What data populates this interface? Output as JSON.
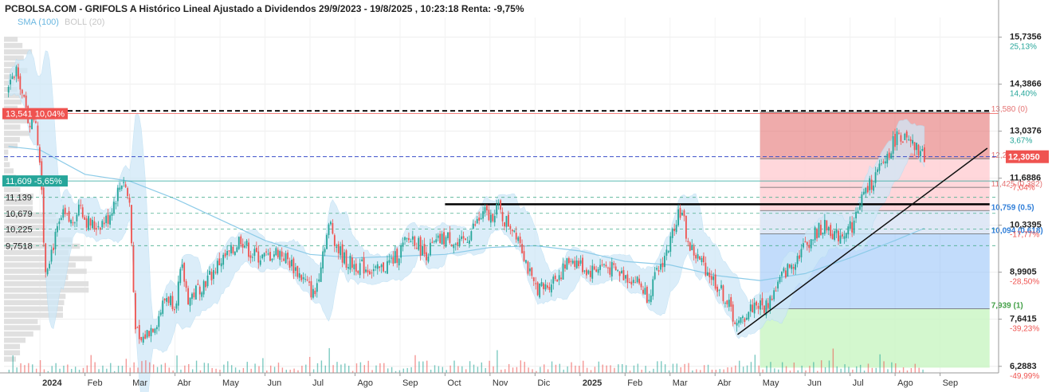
{
  "header": {
    "title": "PCBOLSA.COM - GRIFOLS A Histórico Lineal Ajustado a Dividendos 29/9/2023 - 19/8/2025 , 10:23:18 Renta: -9,75%"
  },
  "indicators": {
    "sma": "SMA (100)",
    "boll": "BOLL (20)"
  },
  "colors": {
    "up": "#26a69a",
    "down": "#ef5350",
    "sma": "#8ccbe8",
    "boll_fill": "#cfe8f7",
    "fib_red": "#e57373",
    "fib_pink": "#ffcdd2",
    "fib_blue": "#90c0f8",
    "fib_green": "#c8f5c2",
    "price_tag": "#ef5350",
    "green_tag": "#26a69a"
  },
  "chart_data": {
    "type": "candlestick",
    "ylim": [
      6.1,
      16.3
    ],
    "y_ticks": [
      {
        "value": 15.7356,
        "label": "15,7356",
        "pct": "25,13%",
        "pct_color": "#26a69a"
      },
      {
        "value": 14.3866,
        "label": "14,3866",
        "pct": "14,40%",
        "pct_color": "#26a69a"
      },
      {
        "value": 13.0376,
        "label": "13,0376",
        "pct": "3,67%",
        "pct_color": "#26a69a"
      },
      {
        "value": 11.6886,
        "label": "11,6886",
        "pct": "-7,04%",
        "pct_color": "#ef5350"
      },
      {
        "value": 10.3395,
        "label": "10,3395",
        "pct": "-17,77%",
        "pct_color": "#ef5350"
      },
      {
        "value": 8.9905,
        "label": "8,9905",
        "pct": "-28,50%",
        "pct_color": "#ef5350"
      },
      {
        "value": 7.6415,
        "label": "7,6415",
        "pct": "-39,23%",
        "pct_color": "#ef5350"
      },
      {
        "value": 6.2883,
        "label": "6,2883",
        "pct": "-49,99%",
        "pct_color": "#ef5350"
      }
    ],
    "x_ticks": [
      {
        "label": "2024",
        "t": 0.0,
        "bold": true
      },
      {
        "label": "Feb",
        "t": 1.0
      },
      {
        "label": "Mar",
        "t": 2.0
      },
      {
        "label": "Abr",
        "t": 3.0
      },
      {
        "label": "May",
        "t": 4.0
      },
      {
        "label": "Jun",
        "t": 5.0
      },
      {
        "label": "Jul",
        "t": 6.0
      },
      {
        "label": "Ago",
        "t": 7.0
      },
      {
        "label": "Sep",
        "t": 8.0
      },
      {
        "label": "Oct",
        "t": 9.0
      },
      {
        "label": "Nov",
        "t": 10.0
      },
      {
        "label": "Dic",
        "t": 11.0
      },
      {
        "label": "2025",
        "t": 12.0,
        "bold": true
      },
      {
        "label": "Feb",
        "t": 13.0
      },
      {
        "label": "Mar",
        "t": 14.0
      },
      {
        "label": "Abr",
        "t": 15.0
      },
      {
        "label": "May",
        "t": 16.0
      },
      {
        "label": "Jun",
        "t": 17.0
      },
      {
        "label": "Jul",
        "t": 18.0
      },
      {
        "label": "Ago",
        "t": 19.0
      },
      {
        "label": "Sep",
        "t": 20.0
      }
    ],
    "price_path": [
      [
        -0.7,
        14.2
      ],
      [
        -0.5,
        14.9
      ],
      [
        -0.4,
        14.1
      ],
      [
        -0.25,
        13.3
      ],
      [
        -0.1,
        13.5
      ],
      [
        0.05,
        11.4
      ],
      [
        0.1,
        9.0
      ],
      [
        0.3,
        9.8
      ],
      [
        0.5,
        10.6
      ],
      [
        0.7,
        10.4
      ],
      [
        0.9,
        11.0
      ],
      [
        1.0,
        10.5
      ],
      [
        1.2,
        10.3
      ],
      [
        1.5,
        10.5
      ],
      [
        1.7,
        11.2
      ],
      [
        1.85,
        11.7
      ],
      [
        2.0,
        10.9
      ],
      [
        2.1,
        7.7
      ],
      [
        2.2,
        6.9
      ],
      [
        2.35,
        7.2
      ],
      [
        2.6,
        7.6
      ],
      [
        2.8,
        8.3
      ],
      [
        3.0,
        8.1
      ],
      [
        3.15,
        9.1
      ],
      [
        3.3,
        8.2
      ],
      [
        3.5,
        8.5
      ],
      [
        3.8,
        8.9
      ],
      [
        4.0,
        9.3
      ],
      [
        4.3,
        9.6
      ],
      [
        4.45,
        10.0
      ],
      [
        4.7,
        9.5
      ],
      [
        5.0,
        9.4
      ],
      [
        5.3,
        9.6
      ],
      [
        5.6,
        9.2
      ],
      [
        5.9,
        8.7
      ],
      [
        6.1,
        8.3
      ],
      [
        6.3,
        9.7
      ],
      [
        6.45,
        10.4
      ],
      [
        6.6,
        9.7
      ],
      [
        6.8,
        9.3
      ],
      [
        7.0,
        9.2
      ],
      [
        7.3,
        9.1
      ],
      [
        7.5,
        9.0
      ],
      [
        7.7,
        9.2
      ],
      [
        7.9,
        9.4
      ],
      [
        8.1,
        9.8
      ],
      [
        8.3,
        10.0
      ],
      [
        8.55,
        9.5
      ],
      [
        8.7,
        9.7
      ],
      [
        8.9,
        9.9
      ],
      [
        9.1,
        10.0
      ],
      [
        9.3,
        9.7
      ],
      [
        9.5,
        10.0
      ],
      [
        9.7,
        10.4
      ],
      [
        9.9,
        10.7
      ],
      [
        10.0,
        10.5
      ],
      [
        10.15,
        10.9
      ],
      [
        10.3,
        10.5
      ],
      [
        10.5,
        10.3
      ],
      [
        10.65,
        10.0
      ],
      [
        10.8,
        9.3
      ],
      [
        10.95,
        8.6
      ],
      [
        11.2,
        8.5
      ],
      [
        11.4,
        8.8
      ],
      [
        11.6,
        9.0
      ],
      [
        11.8,
        9.4
      ],
      [
        12.0,
        9.2
      ],
      [
        12.2,
        9.0
      ],
      [
        12.5,
        9.2
      ],
      [
        12.8,
        9.0
      ],
      [
        13.0,
        8.9
      ],
      [
        13.3,
        8.7
      ],
      [
        13.5,
        8.3
      ],
      [
        13.7,
        8.9
      ],
      [
        13.9,
        9.5
      ],
      [
        14.0,
        9.8
      ],
      [
        14.1,
        10.4
      ],
      [
        14.2,
        10.8
      ],
      [
        14.3,
        10.5
      ],
      [
        14.4,
        9.8
      ],
      [
        14.6,
        9.4
      ],
      [
        14.8,
        9.1
      ],
      [
        15.0,
        8.7
      ],
      [
        15.2,
        8.3
      ],
      [
        15.35,
        7.9
      ],
      [
        15.5,
        7.4
      ],
      [
        15.7,
        7.8
      ],
      [
        15.9,
        8.1
      ],
      [
        16.1,
        7.95
      ],
      [
        16.3,
        8.4
      ],
      [
        16.5,
        8.9
      ],
      [
        16.7,
        9.2
      ],
      [
        16.9,
        9.6
      ],
      [
        17.1,
        9.9
      ],
      [
        17.3,
        10.2
      ],
      [
        17.5,
        10.3
      ],
      [
        17.7,
        10.0
      ],
      [
        17.9,
        10.2
      ],
      [
        18.1,
        10.4
      ],
      [
        18.2,
        11.0
      ],
      [
        18.35,
        11.3
      ],
      [
        18.5,
        11.6
      ],
      [
        18.7,
        12.0
      ],
      [
        18.85,
        12.4
      ],
      [
        19.0,
        12.8
      ],
      [
        19.1,
        13.0
      ],
      [
        19.2,
        12.8
      ],
      [
        19.35,
        12.6
      ],
      [
        19.5,
        12.5
      ],
      [
        19.65,
        12.3
      ]
    ],
    "candle_count": 470,
    "volume_seed": 7,
    "sma_path": [
      [
        -0.7,
        12.6
      ],
      [
        0.0,
        12.5
      ],
      [
        1.0,
        11.8
      ],
      [
        2.0,
        11.6
      ],
      [
        3.0,
        11.1
      ],
      [
        4.0,
        10.5
      ],
      [
        5.0,
        9.9
      ],
      [
        6.0,
        9.5
      ],
      [
        7.0,
        9.4
      ],
      [
        8.0,
        9.45
      ],
      [
        9.0,
        9.5
      ],
      [
        10.0,
        9.7
      ],
      [
        11.0,
        9.75
      ],
      [
        12.0,
        9.6
      ],
      [
        13.0,
        9.3
      ],
      [
        14.0,
        9.2
      ],
      [
        15.0,
        8.9
      ],
      [
        16.0,
        8.75
      ],
      [
        17.0,
        8.95
      ],
      [
        18.0,
        9.4
      ],
      [
        19.0,
        9.9
      ],
      [
        19.65,
        10.25
      ]
    ],
    "levels": {
      "resistance_dotted": {
        "value": 13.62
      },
      "blue_dashed": {
        "value": 12.305
      },
      "horizontal_green": {
        "value": 11.609
      },
      "gray_dashed": [
        11.139,
        10.679,
        10.225,
        9.7518
      ],
      "thick_black": {
        "value": 10.94,
        "from_t": 9.0,
        "to_t": 21.1
      }
    },
    "fibonacci": {
      "from_t": 16.0,
      "to_t": 21.1,
      "levels": [
        {
          "value": 13.58,
          "label": "13,580 (0)",
          "color": "#e57373"
        },
        {
          "value": 12.248,
          "label": "12,248 (0.236)",
          "color": "#e57373"
        },
        {
          "value": 11.425,
          "label": "11,425 (0.382)",
          "color": "#e57373"
        },
        {
          "value": 10.759,
          "label": "10,759 (0.5)",
          "color": "#2f7ed8"
        },
        {
          "value": 10.094,
          "label": "10,094 (0.618)",
          "color": "#2f7ed8"
        },
        {
          "value": 7.939,
          "label": "7,939 (1)",
          "color": "#43a047"
        }
      ]
    },
    "trendline": {
      "from": [
        15.5,
        7.2
      ],
      "to": [
        21.05,
        12.55
      ]
    },
    "left_labels": [
      {
        "label": "13,541  10,04%",
        "value": 13.541,
        "bg": "#ef5350",
        "color": "#ffffff"
      },
      {
        "label": "11,609  -5,65%",
        "value": 11.609,
        "bg": "#26a69a",
        "color": "#ffffff"
      },
      {
        "label": "11,139",
        "value": 11.139,
        "bg": "",
        "color": "#222222"
      },
      {
        "label": "10,679",
        "value": 10.679,
        "bg": "",
        "color": "#222222"
      },
      {
        "label": "10,225",
        "value": 10.225,
        "bg": "",
        "color": "#222222"
      },
      {
        "label": "9,7518",
        "value": 9.7518,
        "bg": "",
        "color": "#222222"
      }
    ],
    "last_price": {
      "label": "12,3050",
      "value": 12.305
    }
  }
}
